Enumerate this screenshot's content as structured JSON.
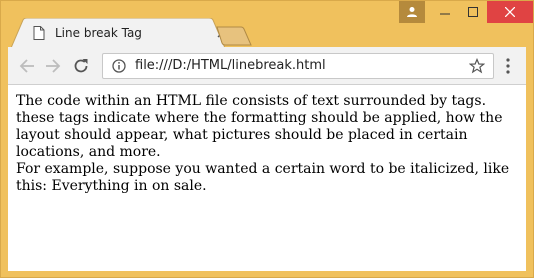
{
  "tab": {
    "title": "Line break Tag"
  },
  "toolbar": {
    "url": "file:///D:/HTML/linebreak.html"
  },
  "page": {
    "paragraph_1": "The code within an HTML file consists of text surrounded by tags. these tags indicate where the formatting should be applied, how the layout should appear, what pictures should be placed in certain locations, and more.",
    "paragraph_2": "For example, suppose you wanted a certain word to be italicized, like this: Everything in on sale."
  },
  "colors": {
    "frame": "#f0c15d",
    "close_button": "#e04343",
    "profile_button": "#b58a3c",
    "tab_inactive": "#e7c27e"
  },
  "icons": {
    "favicon": "page-icon",
    "tab_close": "close-icon",
    "back": "arrow-left-icon",
    "forward": "arrow-right-icon",
    "reload": "reload-icon",
    "info": "info-icon",
    "bookmark": "star-icon",
    "menu": "kebab-menu-icon",
    "profile": "user-icon",
    "minimize": "minimize-icon",
    "maximize": "maximize-icon",
    "close_window": "close-icon"
  }
}
